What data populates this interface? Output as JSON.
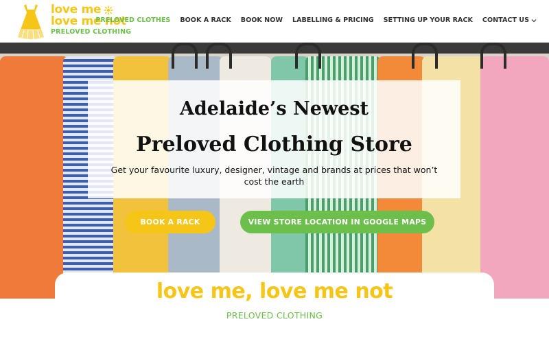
{
  "logo": {
    "line1": "love me",
    "line2": "love me not",
    "subtitle": "PRELOVED CLOTHING"
  },
  "nav": {
    "items": [
      {
        "label": "PRELOVED CLOTHES",
        "active": true
      },
      {
        "label": "BOOK A RACK",
        "active": false
      },
      {
        "label": "BOOK NOW",
        "active": false
      },
      {
        "label": "LABELLING & PRICING",
        "active": false
      },
      {
        "label": "SETTING UP YOUR RACK",
        "active": false
      },
      {
        "label": "CONTACT US",
        "active": false,
        "has_dropdown": true
      }
    ]
  },
  "hero": {
    "title_line1": "Adelaide’s Newest",
    "title_line2": "Preloved Clothing Store",
    "subtitle": "Get your favourite luxury, designer, vintage and brands at prices that won’t cost the earth",
    "book_button": "BOOK A RACK",
    "maps_button": "VIEW STORE LOCATION IN GOOGLE MAPS"
  },
  "brand": {
    "title": "love me, love me not",
    "subtitle": "PRELOVED CLOTHING"
  },
  "colors": {
    "brand_yellow": "#f5c518",
    "brand_green": "#6cbf4a",
    "text_dark": "#333333"
  }
}
